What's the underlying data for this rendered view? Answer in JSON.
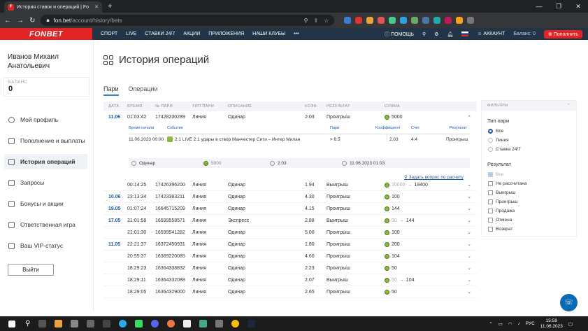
{
  "browser": {
    "tab_title": "История ставок и операций | Fo",
    "favicon_letter": "F",
    "url_host": "fon.bet",
    "url_path": "/account/history/bets"
  },
  "site": {
    "logo": "FONBET",
    "nav": [
      "СПОРТ",
      "LIVE",
      "СТАВКИ 24/7",
      "АКЦИИ",
      "ПРИЛОЖЕНИЯ",
      "НАШИ КЛУБЫ"
    ],
    "more": "•••",
    "help": "ПОМОЩЬ",
    "account": "АККАУНТ",
    "balance": "Баланс: 0",
    "deposit": "Пополнить"
  },
  "sidebar": {
    "user_line1": "Иванов Михаил",
    "user_line2": "Анатольевич",
    "balance_label": "БАЛАНС",
    "balance_value": "0",
    "items": [
      "Мой профиль",
      "Пополнение и выплаты",
      "История операций",
      "Запросы",
      "Бонусы и акции",
      "Ответственная игра",
      "Ваш VIP-статус"
    ],
    "logout": "Выйти"
  },
  "page": {
    "title": "История операций",
    "tabs": [
      "Пари",
      "Операции"
    ]
  },
  "table": {
    "headers": [
      "ДАТА",
      "ВРЕМЯ",
      "№ ПАРИ",
      "ТИП ПАРИ",
      "ОПИСАНИЕ",
      "КОЭФ.",
      "РЕЗУЛЬТАТ",
      "СУММА"
    ],
    "first": {
      "date": "11.06",
      "time": "01:03:42",
      "id": "17428230289",
      "type": "Линия",
      "desc": "Одинар",
      "coef": "2.03",
      "result": "Проигрыш",
      "sum": "5000"
    },
    "detail": {
      "headers": [
        "Время начала",
        "Событие",
        "Пари",
        "Коэффициент",
        "Счет",
        "Результат"
      ],
      "start": "11.06.2023 00:00",
      "event": "2:1 LIVE 2:1 удары в створ Манчестер Сити – Интер Милан",
      "bet": "> 8.5",
      "coef": "2.03",
      "score": "4:4",
      "result": "Проигрыш",
      "sum_type": "Одинар",
      "sum_amount": "5000",
      "sum_coef": "2.03",
      "sum_date": "11.06.2023 01:03"
    },
    "ask": "Задать вопрос по расчету",
    "rows": [
      {
        "date": "",
        "time": "00:14:25",
        "id": "17426396200",
        "type": "Линия",
        "desc": "Одинар",
        "coef": "1.94",
        "result": "Выигрыш",
        "old": "10000",
        "sum": "19400"
      },
      {
        "date": "10.06",
        "time": "23:13:34",
        "id": "17423383211",
        "type": "Линия",
        "desc": "Одинар",
        "coef": "4.30",
        "result": "Проигрыш",
        "old": "",
        "sum": "100"
      },
      {
        "date": "19.05",
        "time": "01:07:24",
        "id": "16645715209",
        "type": "Линия",
        "desc": "Одинар",
        "coef": "4.15",
        "result": "Проигрыш",
        "old": "",
        "sum": "144"
      },
      {
        "date": "17.05",
        "time": "21:01:58",
        "id": "16599558571",
        "type": "Линия",
        "desc": "Экспресс",
        "coef": "2.88",
        "result": "Выигрыш",
        "old": "50",
        "sum": "144"
      },
      {
        "date": "",
        "time": "21:01:30",
        "id": "16599541282",
        "type": "Линия",
        "desc": "Одинар",
        "coef": "5.00",
        "result": "Проигрыш",
        "old": "",
        "sum": "100"
      },
      {
        "date": "11.05",
        "time": "22:21:37",
        "id": "16372450931",
        "type": "Линия",
        "desc": "Одинар",
        "coef": "1.80",
        "result": "Проигрыш",
        "old": "",
        "sum": "200"
      },
      {
        "date": "",
        "time": "20:55:37",
        "id": "16369220085",
        "type": "Линия",
        "desc": "Одинар",
        "coef": "4.60",
        "result": "Проигрыш",
        "old": "",
        "sum": "104"
      },
      {
        "date": "",
        "time": "18:29:23",
        "id": "16364338832",
        "type": "Линия",
        "desc": "Одинар",
        "coef": "2.23",
        "result": "Проигрыш",
        "old": "",
        "sum": "50"
      },
      {
        "date": "",
        "time": "18:29:11",
        "id": "16364332088",
        "type": "Линия",
        "desc": "Одинар",
        "coef": "2.07",
        "result": "Выигрыш",
        "old": "50",
        "sum": "104"
      },
      {
        "date": "",
        "time": "18:29:05",
        "id": "16364329000",
        "type": "Линия",
        "desc": "Одинар",
        "coef": "2.65",
        "result": "Проигрыш",
        "old": "",
        "sum": "50"
      }
    ]
  },
  "filters": {
    "title": "ФИЛЬТРЫ",
    "type_label": "Тип пари",
    "types": [
      "Все",
      "Линия",
      "Ставка 24/7"
    ],
    "result_label": "Результат",
    "results": [
      "Все",
      "Не рассчитана",
      "Выигрыш",
      "Проигрыш",
      "Продажа",
      "Отмена",
      "Возврат"
    ]
  },
  "taskbar": {
    "lang": "РУС",
    "time": "15:59",
    "date": "11.06.2023"
  }
}
